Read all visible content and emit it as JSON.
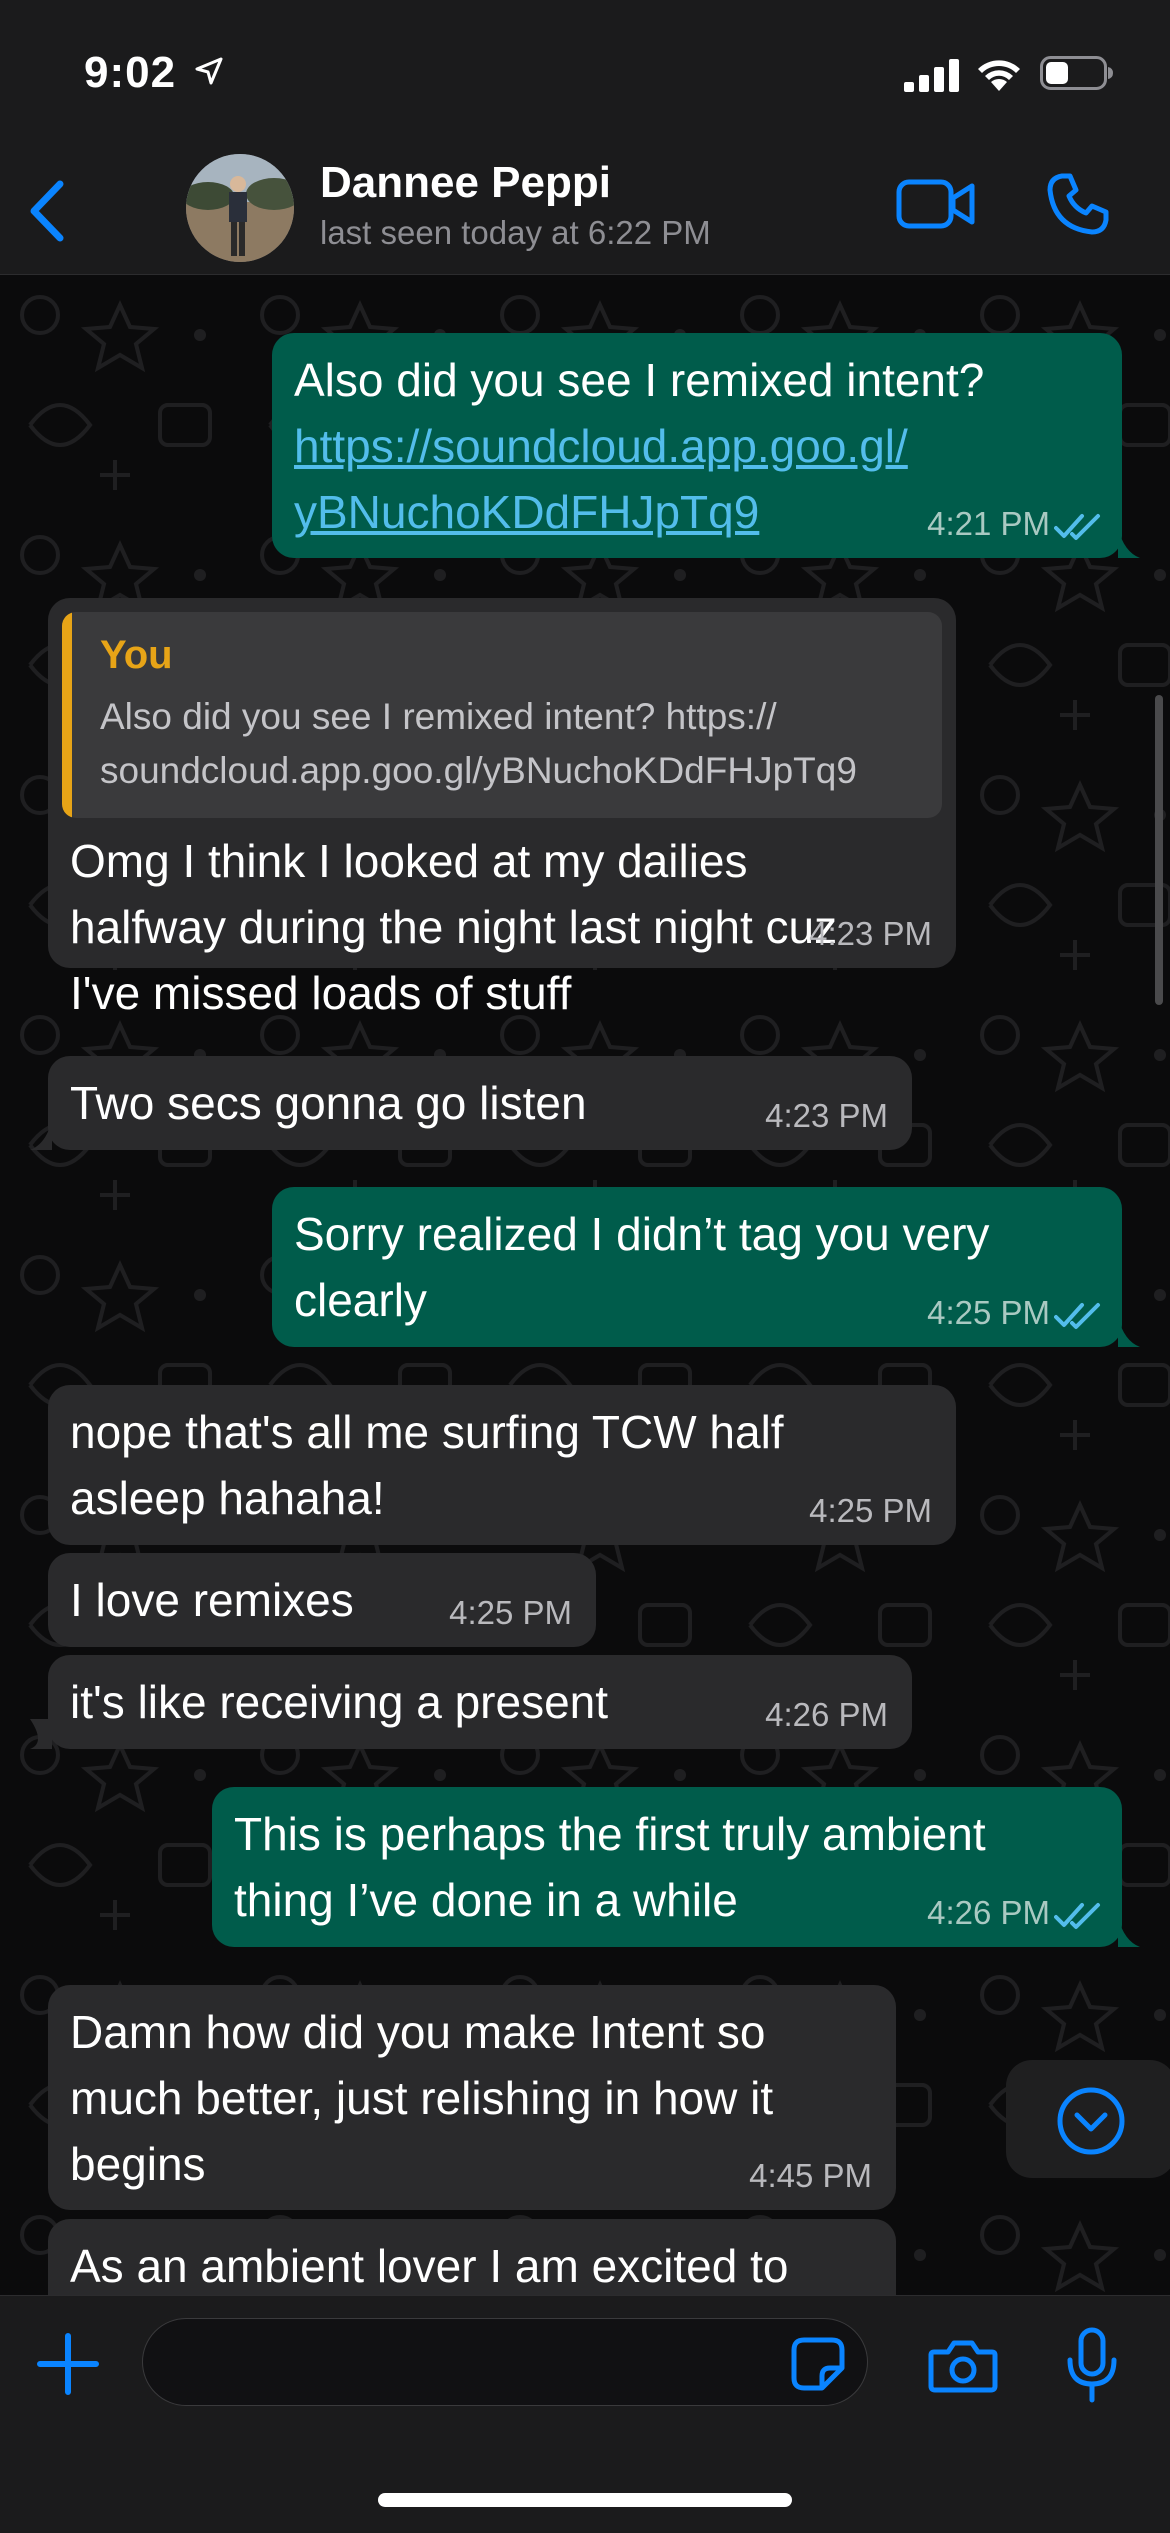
{
  "status_bar": {
    "time": "9:02",
    "icons": [
      "location-arrow-icon",
      "signal-icon",
      "wifi-icon",
      "battery-icon"
    ]
  },
  "header": {
    "contact_name": "Dannee Peppi",
    "contact_status": "last seen today at 6:22 PM",
    "icons": [
      "back-chevron-icon",
      "video-call-icon",
      "phone-call-icon"
    ]
  },
  "messages": [
    {
      "direction": "outgoing",
      "lines": [
        "Also did you see I remixed intent?"
      ],
      "link_lines": [
        "https://soundcloud.app.goo.gl/",
        "yBNuchoKDdFHJpTq9"
      ],
      "time": "4:21 PM",
      "read": true
    },
    {
      "direction": "incoming",
      "reply_to": {
        "author": "You",
        "text_lines": [
          "Also did you see I remixed intent? https://",
          "soundcloud.app.goo.gl/yBNuchoKDdFHJpTq9"
        ]
      },
      "lines": [
        "Omg I think I looked at my dailies",
        "halfway during the night last night cuz",
        "I've missed loads of stuff"
      ],
      "time": "4:23 PM"
    },
    {
      "direction": "incoming",
      "lines": [
        "Two secs gonna go listen"
      ],
      "time": "4:23 PM"
    },
    {
      "direction": "outgoing",
      "lines": [
        "Sorry realized I didn’t tag you very",
        "clearly"
      ],
      "time": "4:25 PM",
      "read": true
    },
    {
      "direction": "incoming",
      "lines": [
        "nope that's all me surfing TCW half",
        "asleep hahaha!"
      ],
      "time": "4:25 PM"
    },
    {
      "direction": "incoming",
      "lines": [
        "I love remixes"
      ],
      "time": "4:25 PM"
    },
    {
      "direction": "incoming",
      "lines": [
        "it's like receiving a present"
      ],
      "time": "4:26 PM"
    },
    {
      "direction": "outgoing",
      "lines": [
        "This is perhaps the first truly ambient",
        "thing I’ve done in a while"
      ],
      "time": "4:26 PM",
      "read": true
    },
    {
      "direction": "incoming",
      "lines": [
        "Damn how did you make Intent so",
        "much better, just relishing in how it",
        "begins"
      ],
      "time": "4:45 PM"
    },
    {
      "direction": "incoming",
      "lines": [
        "As an ambient lover I am excited to"
      ],
      "time": ""
    }
  ],
  "composer": {
    "icons": [
      "plus-icon",
      "sticker-icon",
      "camera-icon",
      "microphone-icon"
    ],
    "input_value": ""
  },
  "scroll_down": {
    "icon": "chevron-down-circle-icon"
  },
  "colors": {
    "accent": "#0a84ff",
    "outgoing_bubble": "#005c4b",
    "incoming_bubble": "#2a2a2c",
    "quote_author": "#e7a417",
    "link": "#53bdeb",
    "read_ticks": "#53bdeb"
  }
}
